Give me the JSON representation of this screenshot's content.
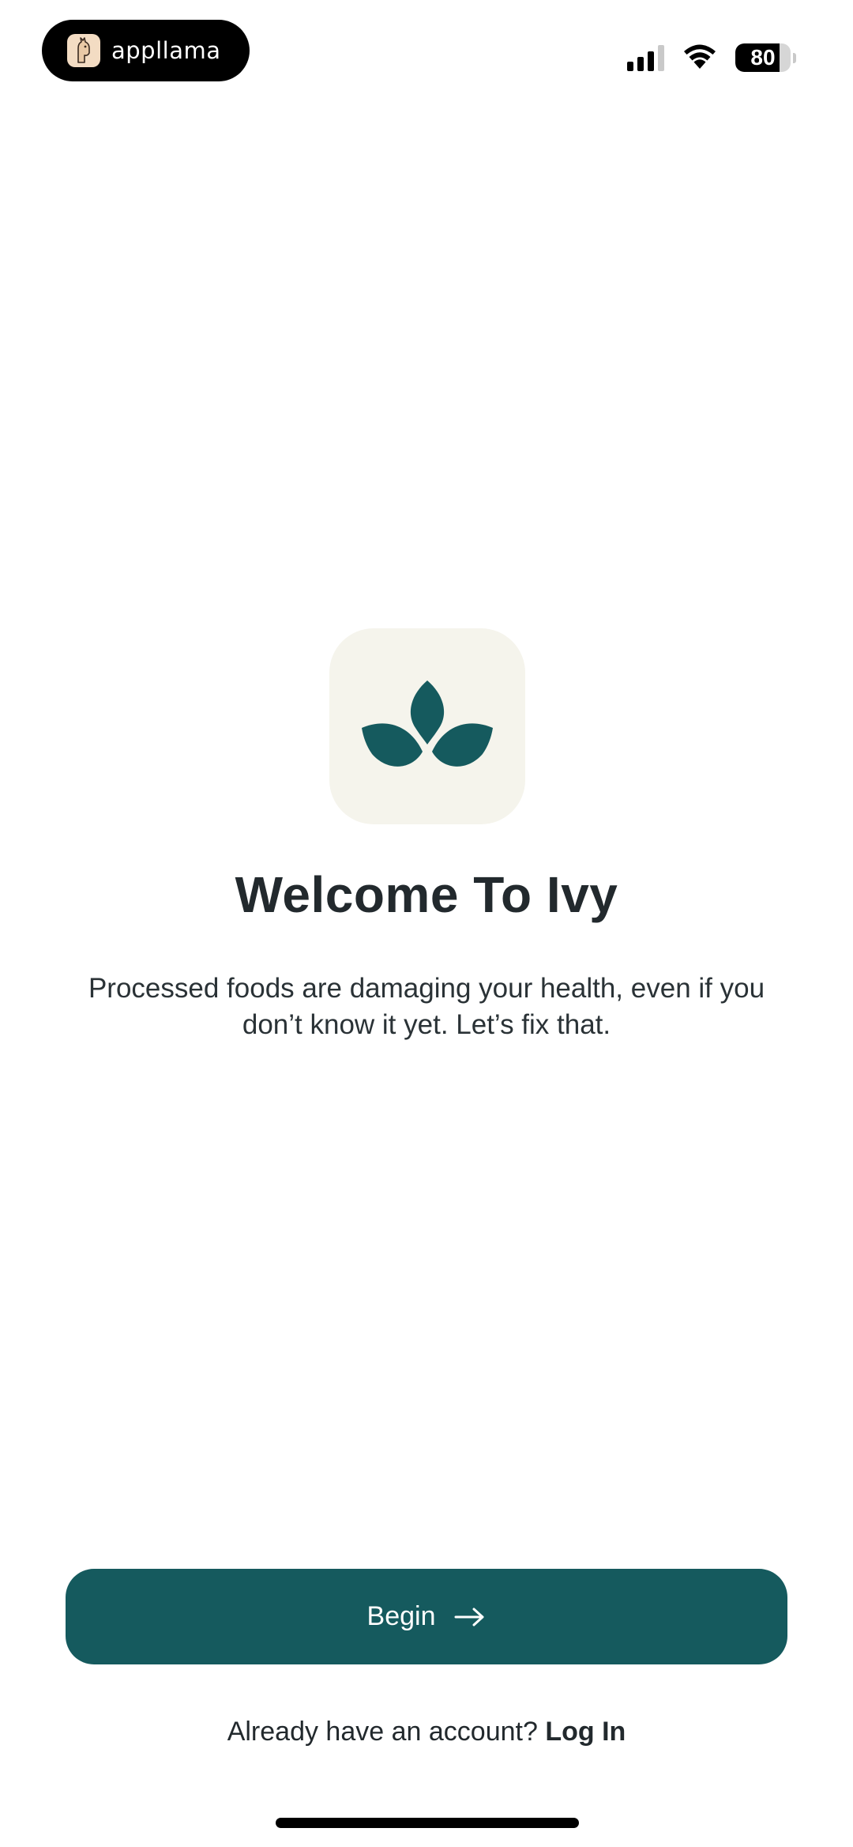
{
  "status_bar": {
    "pill_label": "appllama",
    "battery_percent": "80",
    "battery_level": 0.8,
    "icons": [
      "llama-logo-icon",
      "cellular-signal-icon",
      "wifi-icon",
      "battery-icon"
    ]
  },
  "welcome": {
    "app_icon": "leaf-logo-icon",
    "title": "Welcome To Ivy",
    "subtitle": "Processed foods are damaging your health, even if you don’t know it yet. Let’s fix that."
  },
  "actions": {
    "begin_label": "Begin",
    "begin_icon": "arrow-right-icon",
    "login_prompt": "Already have an account?",
    "login_link": "Log In"
  },
  "colors": {
    "primary": "#155a5e",
    "icon_background": "#f5f4ec",
    "text": "#22292d"
  }
}
